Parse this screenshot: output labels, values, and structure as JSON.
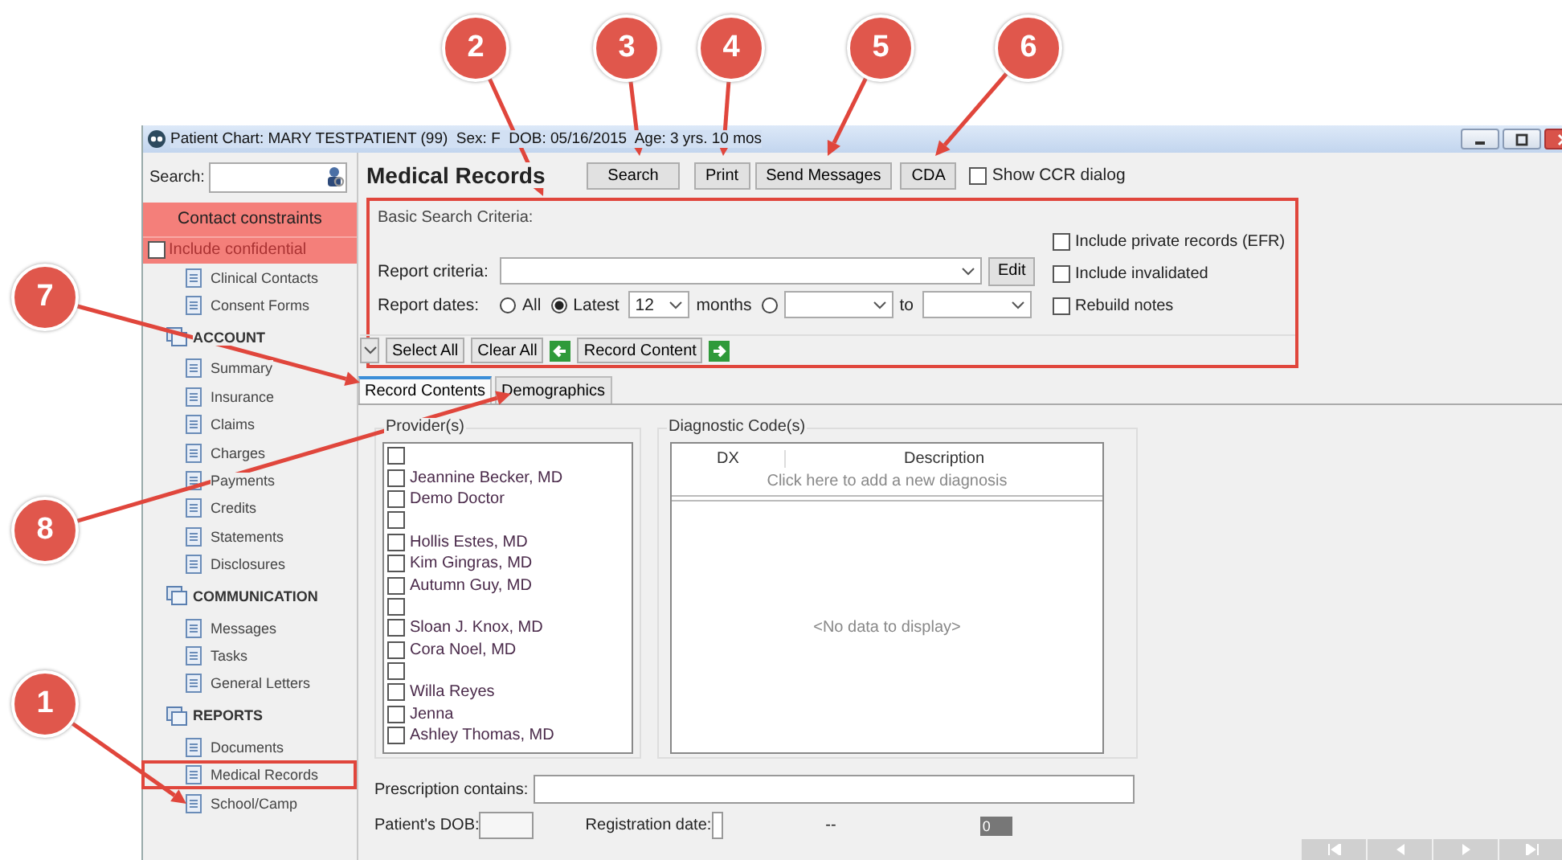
{
  "window": {
    "title": "Patient Chart: MARY TESTPATIENT (99)  Sex: F  DOB: 05/16/2015  Age: 3 yrs. 10 mos"
  },
  "sidebar": {
    "search_label": "Search:",
    "constraints_title": "Contact constraints",
    "include_confidential": {
      "label": "Include confidential",
      "checked": false
    },
    "items": [
      {
        "kind": "item",
        "label": "Clinical Contacts",
        "highlighted": false
      },
      {
        "kind": "item",
        "label": "Consent Forms",
        "highlighted": false
      },
      {
        "kind": "header",
        "label": "ACCOUNT"
      },
      {
        "kind": "item",
        "label": "Summary",
        "highlighted": false
      },
      {
        "kind": "item",
        "label": "Insurance",
        "highlighted": false
      },
      {
        "kind": "item",
        "label": "Claims",
        "highlighted": false
      },
      {
        "kind": "item",
        "label": "Charges",
        "highlighted": false
      },
      {
        "kind": "item",
        "label": "Payments",
        "highlighted": false
      },
      {
        "kind": "item",
        "label": "Credits",
        "highlighted": false
      },
      {
        "kind": "item",
        "label": "Statements",
        "highlighted": false
      },
      {
        "kind": "item",
        "label": "Disclosures",
        "highlighted": false
      },
      {
        "kind": "header",
        "label": "COMMUNICATION"
      },
      {
        "kind": "item",
        "label": "Messages",
        "highlighted": false
      },
      {
        "kind": "item",
        "label": "Tasks",
        "highlighted": false
      },
      {
        "kind": "item",
        "label": "General Letters",
        "highlighted": false
      },
      {
        "kind": "header",
        "label": "REPORTS"
      },
      {
        "kind": "item",
        "label": "Documents",
        "highlighted": false
      },
      {
        "kind": "item",
        "label": "Medical Records",
        "highlighted": true
      },
      {
        "kind": "item",
        "label": "School/Camp",
        "highlighted": false
      }
    ]
  },
  "page_title": "Medical Records",
  "buttons": [
    "Search",
    "Print",
    "Send Messages",
    "CDA"
  ],
  "show_ccr": {
    "label": "Show CCR dialog",
    "checked": false
  },
  "search_criteria": {
    "title": "Basic Search Criteria:",
    "highlighted": true,
    "report_criteria_label": "Report criteria:",
    "edit_button": "Edit",
    "report_dates_label": "Report dates:",
    "date_options": [
      {
        "label": "All",
        "selected": false
      },
      {
        "label": "Latest",
        "selected": true
      },
      {
        "selected": false
      }
    ],
    "latest_value": "12",
    "months_label": "months",
    "to_label": "to",
    "options": [
      {
        "label": "Include private records (EFR)",
        "checked": false
      },
      {
        "label": "Include invalidated",
        "checked": false
      },
      {
        "label": "Rebuild notes",
        "checked": false
      }
    ],
    "actions": [
      {
        "kind": "caret"
      },
      {
        "kind": "button",
        "label": "Select All"
      },
      {
        "kind": "button",
        "label": "Clear All"
      },
      {
        "kind": "back"
      },
      {
        "kind": "button",
        "label": "Record Content"
      },
      {
        "kind": "forward"
      }
    ]
  },
  "tabs": [
    {
      "label": "Record Contents",
      "selected": true
    },
    {
      "label": "Demographics",
      "selected": false
    }
  ],
  "providers": {
    "title": "Provider(s)",
    "items": [
      {
        "checked": false
      },
      {
        "name": "Jeannine Becker, MD",
        "checked": false
      },
      {
        "name": "Demo Doctor",
        "checked": false
      },
      {
        "checked": false
      },
      {
        "name": "Hollis Estes, MD",
        "checked": false
      },
      {
        "name": "Kim Gingras, MD",
        "checked": false
      },
      {
        "name": "Autumn Guy, MD",
        "checked": false
      },
      {
        "checked": false
      },
      {
        "name": "Sloan J. Knox, MD",
        "checked": false
      },
      {
        "name": "Cora Noel, MD",
        "checked": false
      },
      {
        "checked": false
      },
      {
        "name": "Willa Reyes",
        "checked": false
      },
      {
        "name": "Jenna",
        "checked": false
      },
      {
        "name": "Ashley Thomas, MD",
        "checked": false
      }
    ]
  },
  "diagnostic_codes": {
    "title": "Diagnostic Code(s)",
    "columns": [
      "DX",
      "Description"
    ],
    "add_row": "Click here to add a new diagnosis",
    "empty_text": "<No data to display>"
  },
  "prescription_label": "Prescription contains:",
  "footer": {
    "dob_label": "Patient's DOB:",
    "registration_label": "Registration date:",
    "separator": "--",
    "count": "0"
  },
  "callouts": [
    {
      "label": "2"
    },
    {
      "label": "3"
    },
    {
      "label": "4"
    },
    {
      "label": "5"
    },
    {
      "label": "6"
    },
    {
      "label": "7"
    },
    {
      "label": "8"
    },
    {
      "label": "1"
    }
  ]
}
